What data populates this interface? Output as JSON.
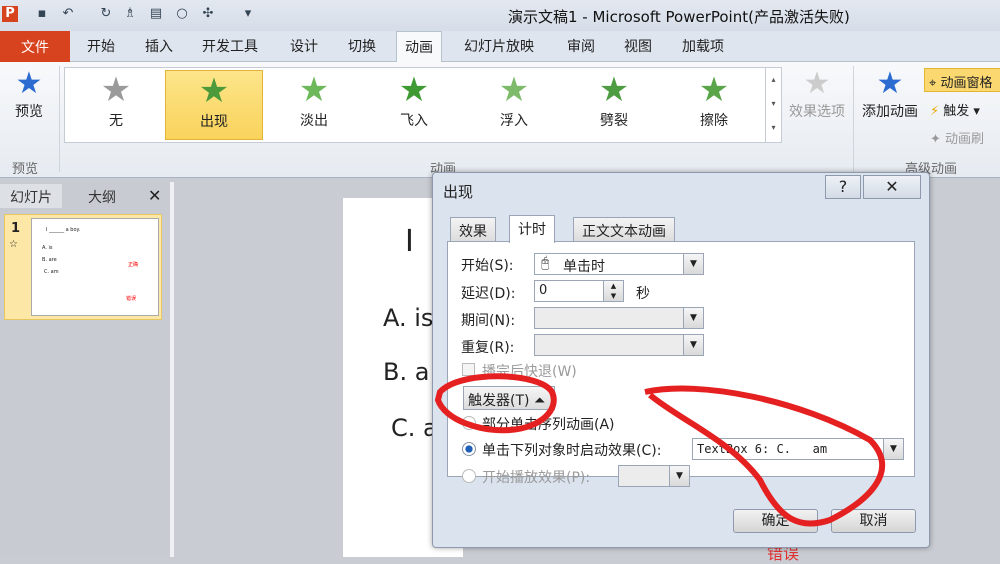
{
  "titlebar": {
    "title": "演示文稿1 - Microsoft PowerPoint(产品激活失败)"
  },
  "tabs": [
    {
      "label": "文件"
    },
    {
      "label": "开始"
    },
    {
      "label": "插入"
    },
    {
      "label": "开发工具"
    },
    {
      "label": "设计"
    },
    {
      "label": "切换"
    },
    {
      "label": "动画"
    },
    {
      "label": "幻灯片放映"
    },
    {
      "label": "审阅"
    },
    {
      "label": "视图"
    },
    {
      "label": "加载项"
    }
  ],
  "ribbon": {
    "preview": {
      "label": "预览",
      "group": "预览"
    },
    "gallery": [
      {
        "label": "无",
        "color": "#9a9a9a"
      },
      {
        "label": "出现",
        "color": "#4c9a3a"
      },
      {
        "label": "淡出",
        "color": "#6cb85a"
      },
      {
        "label": "飞入",
        "color": "#3f9a34"
      },
      {
        "label": "浮入",
        "color": "#7dbb6b"
      },
      {
        "label": "劈裂",
        "color": "#4f9d42"
      },
      {
        "label": "擦除",
        "color": "#5aa54a"
      }
    ],
    "animation_group": "动画",
    "effect_options": "效果选项",
    "add_animation": "添加动画",
    "animation_pane": "动画窗格",
    "trigger": "触发",
    "animation_painter": "动画刷",
    "advanced_group": "高级动画"
  },
  "leftpanel": {
    "tabs": [
      "幻灯片",
      "大纲"
    ],
    "slide_number": "1",
    "thumb": {
      "line1": "I ______ a boy.",
      "a": "A. is",
      "b": "B. are",
      "c": "C. am",
      "correct": "正确",
      "wrong": "错误"
    }
  },
  "slide": {
    "title": "I",
    "a": "A. is",
    "b": "B. a",
    "c": "C. a",
    "bottom": "错误"
  },
  "dialog": {
    "title": "出现",
    "help": "?",
    "close": "✕",
    "tabs": [
      "效果",
      "计时",
      "正文文本动画"
    ],
    "start_label": "开始(S):",
    "start_value": "单击时",
    "delay_label": "延迟(D):",
    "delay_value": "0",
    "delay_unit": "秒",
    "duration_label": "期间(N):",
    "repeat_label": "重复(R):",
    "rewind_label": "播完后快退(W)",
    "triggers_button": "触发器(T)",
    "radio1": "部分单击序列动画(A)",
    "radio2": "单击下列对象时启动效果(C):",
    "radio2_value": "TextBox 6: C.   am",
    "radio3": "开始播放效果(P):",
    "ok": "确定",
    "cancel": "取消"
  }
}
